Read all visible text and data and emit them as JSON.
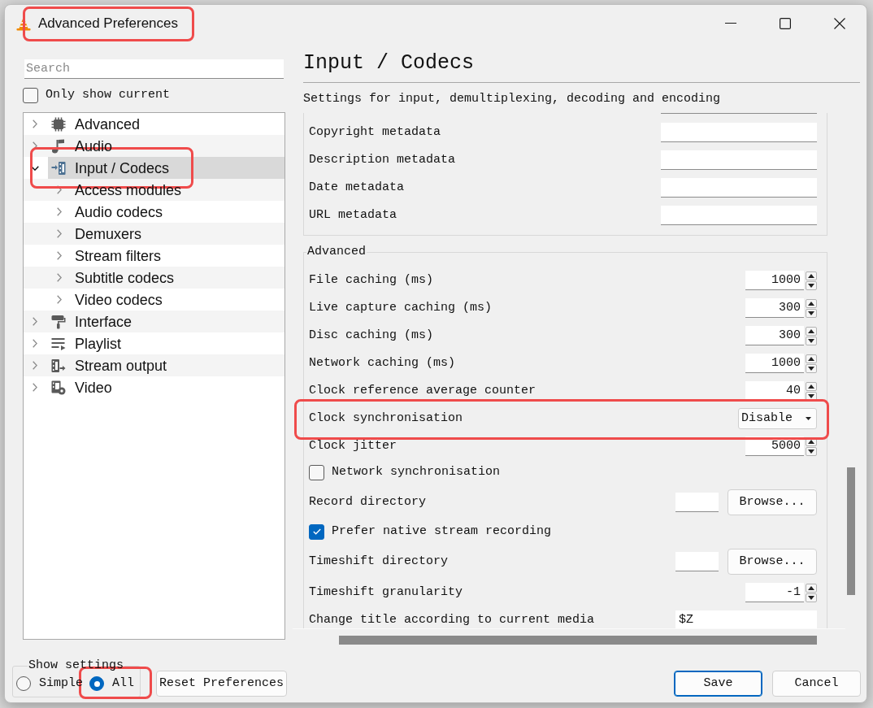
{
  "window": {
    "title": "Advanced Preferences",
    "highlighted": true
  },
  "sidebar": {
    "search": {
      "placeholder": "Search"
    },
    "only_show_current": {
      "label": "Only show current",
      "checked": false
    },
    "tree": [
      {
        "label": "Advanced",
        "expanded": false,
        "selected": false,
        "highlighted": false
      },
      {
        "label": "Audio",
        "expanded": false,
        "selected": false,
        "highlighted": false
      },
      {
        "label": "Input / Codecs",
        "expanded": true,
        "selected": true,
        "highlighted": true,
        "children": [
          {
            "label": "Access modules",
            "expanded": false,
            "selected": false,
            "highlighted": false
          },
          {
            "label": "Audio codecs",
            "expanded": false,
            "selected": false,
            "highlighted": false
          },
          {
            "label": "Demuxers",
            "expanded": false,
            "selected": false,
            "highlighted": false
          },
          {
            "label": "Stream filters",
            "expanded": false,
            "selected": false,
            "highlighted": false
          },
          {
            "label": "Subtitle codecs",
            "expanded": false,
            "selected": false,
            "highlighted": false
          },
          {
            "label": "Video codecs",
            "expanded": false,
            "selected": false,
            "highlighted": false
          }
        ]
      },
      {
        "label": "Interface",
        "expanded": false,
        "selected": false,
        "highlighted": false
      },
      {
        "label": "Playlist",
        "expanded": false,
        "selected": false,
        "highlighted": false
      },
      {
        "label": "Stream output",
        "expanded": false,
        "selected": false,
        "highlighted": false
      },
      {
        "label": "Video",
        "expanded": false,
        "selected": false,
        "highlighted": false
      }
    ]
  },
  "panel": {
    "title": "Input / Codecs",
    "subtitle": "Settings for input, demultiplexing, decoding and encoding",
    "groups": [
      {
        "settings": [
          {
            "kind": "text",
            "label": "Copyright metadata",
            "highlighted": false
          },
          {
            "kind": "text",
            "label": "Description metadata",
            "highlighted": false
          },
          {
            "kind": "text",
            "label": "Date metadata",
            "highlighted": false
          },
          {
            "kind": "text",
            "label": "URL metadata",
            "highlighted": false
          }
        ]
      },
      {
        "title": "Advanced",
        "settings": [
          {
            "kind": "spin",
            "label": "File caching (ms)",
            "value": "1000",
            "highlighted": false
          },
          {
            "kind": "spin",
            "label": "Live capture caching (ms)",
            "value": "300",
            "highlighted": false
          },
          {
            "kind": "spin",
            "label": "Disc caching (ms)",
            "value": "300",
            "highlighted": false
          },
          {
            "kind": "spin",
            "label": "Network caching (ms)",
            "value": "1000",
            "highlighted": false
          },
          {
            "kind": "spin",
            "label": "Clock reference average counter",
            "value": "40",
            "highlighted": false
          },
          {
            "kind": "combo",
            "label": "Clock synchronisation",
            "value": "Disable",
            "highlighted": true
          },
          {
            "kind": "spin",
            "label": "Clock jitter",
            "value": "5000",
            "highlighted": false
          },
          {
            "kind": "checkbox",
            "label": "Network synchronisation",
            "checked": false,
            "highlighted": false
          },
          {
            "kind": "directory",
            "label": "Record directory",
            "button": "Browse...",
            "highlighted": false
          },
          {
            "kind": "checkbox",
            "label": "Prefer native stream recording",
            "checked": true,
            "highlighted": false
          },
          {
            "kind": "directory",
            "label": "Timeshift directory",
            "button": "Browse...",
            "highlighted": false
          },
          {
            "kind": "spin",
            "label": "Timeshift granularity",
            "value": "-1",
            "highlighted": false
          },
          {
            "kind": "text",
            "label": "Change title according to current media",
            "value": "$Z",
            "highlighted": false
          }
        ]
      }
    ]
  },
  "show_settings": {
    "title": "Show settings",
    "options": [
      {
        "label": "Simple",
        "selected": false,
        "highlighted": false
      },
      {
        "label": "All",
        "selected": true,
        "highlighted": true
      }
    ]
  },
  "reset_button": {
    "label": "Reset Preferences"
  },
  "dialog_buttons": [
    {
      "label": "Save",
      "focused": true
    },
    {
      "label": "Cancel",
      "focused": false
    }
  ]
}
